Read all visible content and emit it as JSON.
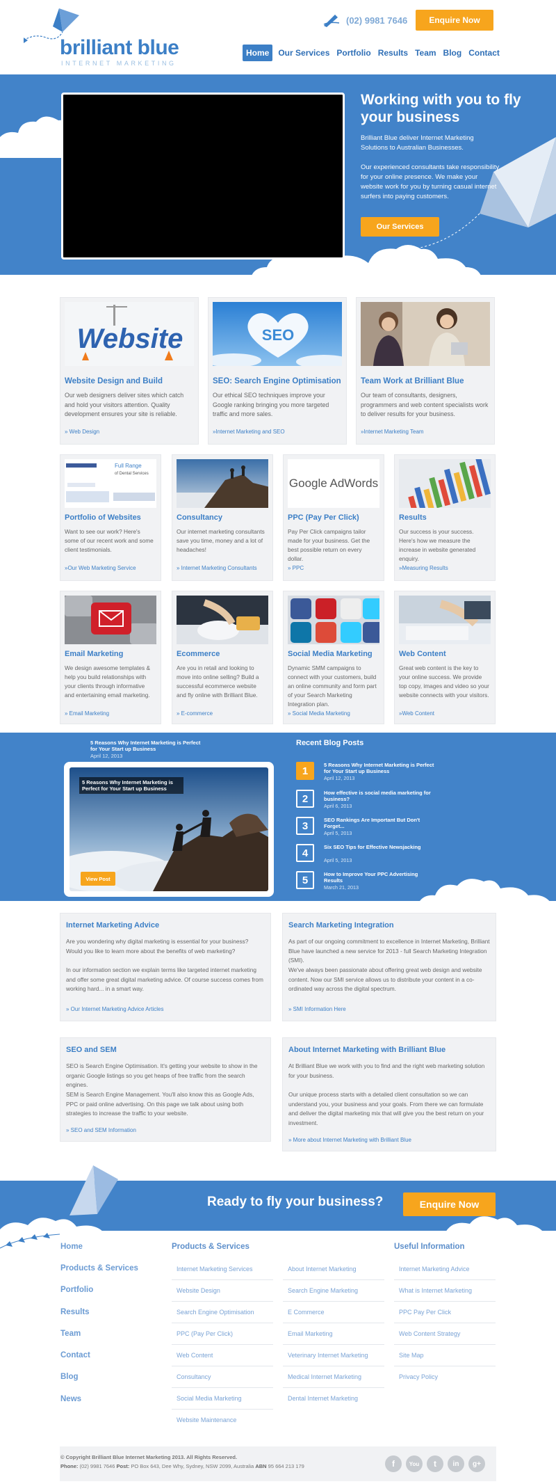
{
  "header": {
    "brand": "brilliant blue",
    "tagline": "INTERNET MARKETING",
    "phone": "(02) 9981 7646",
    "enquire_label": "Enquire Now",
    "nav": [
      "Home",
      "Our Services",
      "Portfolio",
      "Results",
      "Team",
      "Blog",
      "Contact"
    ],
    "nav_active": "Home"
  },
  "hero": {
    "title": "Working with you to fly your business",
    "para1": "Brilliant Blue deliver Internet Marketing Solutions to Australian Businesses.",
    "para2": "Our experienced consultants take responsibility for your online presence. We make your website work for you by turning casual internet surfers into paying customers.",
    "button": "Our Services"
  },
  "featured_cards": [
    {
      "title": "Website Design and Build",
      "text": "Our web designers deliver sites which catch and hold your visitors attention. Quality development ensures your site is reliable.",
      "link": "» Web Design",
      "image": "Website 3D letters"
    },
    {
      "title": "SEO: Search Engine Optimisation",
      "text": "Our ethical SEO techniques improve your Google ranking bringing you more targeted traffic and more sales.",
      "link": "»Internet Marketing and SEO",
      "image": "SEO cloud in blue sky"
    },
    {
      "title": "Team Work at Brilliant Blue",
      "text": "Our team of consultants, designers, programmers and web content specialists work to deliver results for your business.",
      "link": "»Internet Marketing Team",
      "image": "Team meeting"
    }
  ],
  "service_cards": [
    {
      "title": "Portfolio of Websites",
      "text": "Want to see our work? Here's some of our recent work and some client testimonials.",
      "link": "»Our Web Marketing Service",
      "thumb_text": "Full Range of Dental Services"
    },
    {
      "title": "Consultancy",
      "text": "Our internet marketing consultants save you time, money and a lot of headaches!",
      "link": "» Internet Marketing Consultants"
    },
    {
      "title": "PPC (Pay Per Click)",
      "text": "Pay Per Click campaigns tailor made for your business. Get the best possible return on every dollar.",
      "link": "» PPC",
      "thumb_text": "Google AdWords"
    },
    {
      "title": "Results",
      "text": "Our success is your success. Here's how we measure the increase in website generated enquiry.",
      "link": "»Measuring Results"
    },
    {
      "title": "Email Marketing",
      "text": "We design awesome templates & help you build relationships with your clients through informative and entertaining email marketing.",
      "link": "» Email Marketing"
    },
    {
      "title": "Ecommerce",
      "text": "Are you in retail and looking to move into online selling? Build a successful ecommerce website and fly online with Brilliant Blue.",
      "link": "» E-commerce"
    },
    {
      "title": "Social Media Marketing",
      "text": "Dynamic SMM campaigns to connect with your customers, build an online community and form part of your Search Marketing Integration plan.",
      "link": "» Social Media Marketing"
    },
    {
      "title": "Web Content",
      "text": "Great web content is the key to your online success. We provide top copy, images and video so your website connects with your visitors.",
      "link": "»Web Content"
    }
  ],
  "blog": {
    "featured_title": "5 Reasons Why Internet Marketing is Perfect for Your Start up Business",
    "featured_date": "April 12, 2013",
    "view_post": "View Post",
    "recent_heading": "Recent Blog Posts",
    "posts": [
      {
        "num": "1",
        "title": "5 Reasons Why Internet Marketing is Perfect for Your Start up Business",
        "date": "April 12, 2013"
      },
      {
        "num": "2",
        "title": "How effective is social media marketing for business?",
        "date": "April 6, 2013"
      },
      {
        "num": "3",
        "title": "SEO Rankings Are Important But Don't Forget...",
        "date": "April 5, 2013"
      },
      {
        "num": "4",
        "title": "Six SEO Tips for Effective Newsjacking",
        "date": "April 5, 2013"
      },
      {
        "num": "5",
        "title": "How to Improve Your PPC Advertising Results",
        "date": "March 21, 2013"
      }
    ]
  },
  "info_boxes": [
    {
      "title": "Internet Marketing Advice",
      "p1": "Are you wondering why digital marketing is essential for your business? Would you like to learn more about the benefits of web marketing?",
      "p2": "In our information section we explain terms like targeted internet marketing and offer some great digital marketing advice. Of course success comes from working hard... in a smart way.",
      "link": "» Our Internet Marketing Advice Articles"
    },
    {
      "title": "Search Marketing Integration",
      "p1": "As part of our ongoing commitment to excellence in Internet Marketing, Brilliant Blue have launched a new service for 2013 - full Search Marketing Integration (SMI).",
      "p2": "We've always been passionate about offering great web design and website content. Now our SMI service allows us to distribute your content in a co-ordinated way across the digital spectrum.",
      "link": "» SMI Information Here"
    },
    {
      "title": "SEO and SEM",
      "p1": "SEO is Search Engine Optimisation. It's getting your website to show in the organic Google listings so you get heaps of free traffic from the search engines.",
      "p2": "SEM is Search Engine Management. You'll also know this as Google Ads, PPC or paid online advertising. On this page we talk about using both strategies to increase the traffic to your website.",
      "link": "» SEO and SEM Information"
    },
    {
      "title": "About Internet Marketing with Brilliant Blue",
      "p1": "At Brilliant Blue we work with you to find and the right web marketing solution for your business.",
      "p2": "Our unique process starts with a detailed client consultation so we can understand you, your business and your goals. From there we can formulate and deliver the digital marketing mix that will give you the best return on your investment.",
      "link": "» More about Internet Marketing with Brilliant Blue"
    }
  ],
  "cta": {
    "text": "Ready to fly your business?",
    "button": "Enquire Now"
  },
  "footer": {
    "main_links": [
      "Home",
      "Products & Services",
      "Portfolio",
      "Results",
      "Team",
      "Contact",
      "Blog",
      "News"
    ],
    "products_heading": "Products & Services",
    "products_col1": [
      "Internet Marketing Services",
      "Website Design",
      "Search Engine Optimisation",
      "PPC (Pay Per Click)",
      "Web Content",
      "Consultancy",
      "Social Media Marketing",
      "Website Maintenance"
    ],
    "products_col2": [
      "About Internet Marketing",
      "Search Engine Marketing",
      "E Commerce",
      "Email Marketing",
      "Veterinary Internet Marketing",
      "Medical Internet Marketing",
      "Dental Internet Marketing"
    ],
    "useful_heading": "Useful Information",
    "useful_links": [
      "Internet Marketing Advice",
      "What is Internet Marketing",
      "PPC Pay Per Click",
      "Web Content Strategy",
      "Site Map",
      "Privacy Policy"
    ],
    "copyright": "© Copyright Brilliant Blue Internet Marketing 2013. All Rights Reserved.",
    "phone_label": "Phone:",
    "phone": "(02) 9981 7646",
    "post_label": "Post:",
    "post": "PO Box 643, Dee Why, Sydney, NSW 2099, Australia",
    "abn_label": "ABN",
    "abn": "95 664 213 179",
    "social": [
      "f",
      "You",
      "t",
      "in",
      "g+"
    ]
  }
}
